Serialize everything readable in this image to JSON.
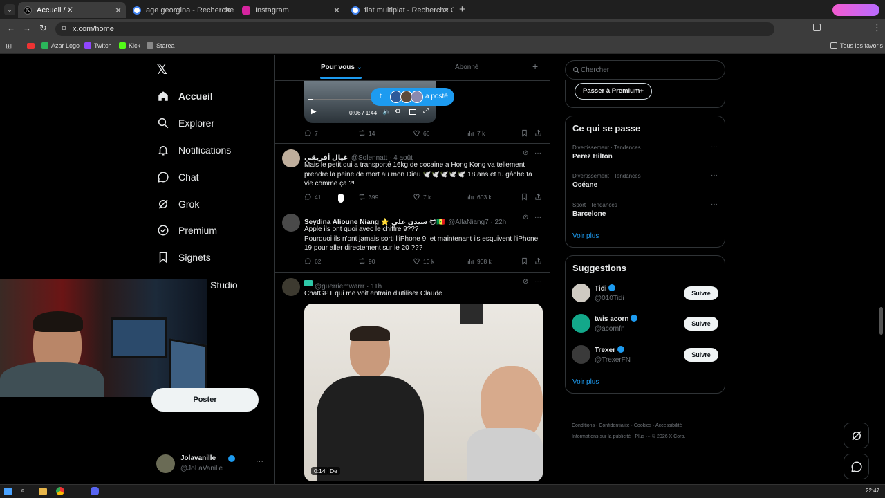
{
  "browser": {
    "tabs": [
      {
        "title": "Accueil / X"
      },
      {
        "title": "age georgina - Recherche Goog"
      },
      {
        "title": "Instagram"
      },
      {
        "title": "fiat multiplat - Recherche Goog"
      }
    ],
    "url": "x.com/home",
    "bookmarks": [
      "Azar Logo",
      "Twitch",
      "Kick",
      "Starea"
    ],
    "all_bookmarks": "Tous les favoris"
  },
  "nav": {
    "items": [
      "Accueil",
      "Explorer",
      "Notifications",
      "Chat",
      "Grok",
      "Premium",
      "Signets",
      "Studio"
    ],
    "post_button": "Poster",
    "account": {
      "name": "Jolavanille",
      "handle": "@JoLaVanille"
    }
  },
  "feed": {
    "tabs": [
      "Pour vous",
      "Abonné"
    ],
    "posted_pill": "a posté",
    "video_time": "0:06 / 1:44",
    "tweets": [
      {
        "replies": "7",
        "retweets": "14",
        "likes": "66",
        "views": "7 k"
      },
      {
        "name": "غيال أفريقي",
        "handle": "@Solennatt · 4 août",
        "text": "Mais le petit qui a transporté 16kg de cocaine a Hong Kong va tellement prendre la peine de mort au mon Dieu 🕊️🕊️🕊️🕊️🕊️ 18 ans et tu gâche ta vie comme ça ?!",
        "replies": "41",
        "retweets": "399",
        "likes": "7 k",
        "views": "603 k"
      },
      {
        "name": "Seydina Alioune Niang ⭐ سيدن علي 😎🇸🇳",
        "handle": "@AllaNiang7 · 22h",
        "text": "Apple ils ont quoi avec le chiffre 9???\nPourquoi ils n'ont jamais sorti l'iPhone 9, et maintenant ils esquivent l'iPhone 19 pour aller directement sur le 20 ???",
        "replies": "62",
        "retweets": "90",
        "likes": "10 k",
        "views": "908 k"
      },
      {
        "handle": "@guerriemwarrr · 11h",
        "text": "ChatGPT qui me voit entrain d'utiliser Claude",
        "video_time": "0:14",
        "video_label": "De"
      }
    ]
  },
  "sidebar": {
    "search_placeholder": "Chercher",
    "premium_button": "Passer à Premium+",
    "trends_title": "Ce qui se passe",
    "trends": [
      {
        "category": "Divertissement · Tendances",
        "name": "Perez Hilton"
      },
      {
        "category": "Divertissement · Tendances",
        "name": "Océane"
      },
      {
        "category": "Sport · Tendances",
        "name": "Barcelone"
      }
    ],
    "see_more": "Voir plus",
    "suggestions_title": "Suggestions",
    "suggestions": [
      {
        "name": "Tidi",
        "handle": "@010Tidi"
      },
      {
        "name": "twis acorn",
        "handle": "@acornfn"
      },
      {
        "name": "Trexer",
        "handle": "@TrexerFN"
      }
    ],
    "follow_label": "Suivre",
    "footer_line1": "Conditions · Confidentialité · Cookies · Accessibilité ·",
    "footer_line2": "Informations sur la publicité · Plus ··· © 2026 X Corp."
  },
  "taskbar": {
    "time": "22:47"
  },
  "colors": {
    "accent": "#1d9bf0",
    "text": "#e7e9ea",
    "muted": "#71767b",
    "border": "#2f3336"
  }
}
